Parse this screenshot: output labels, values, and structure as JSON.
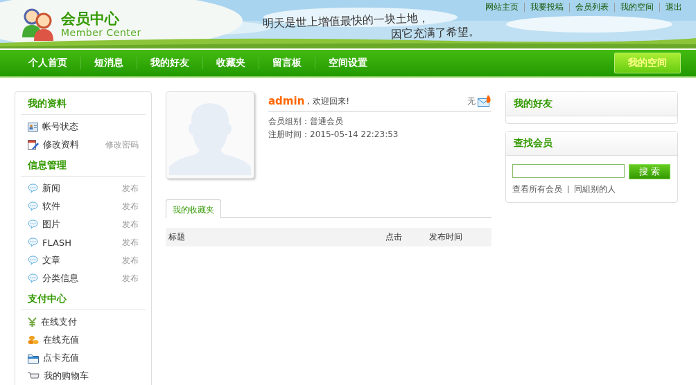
{
  "header": {
    "logo_title": "会员中心",
    "logo_subtitle": "Member Center",
    "slogan": [
      "明天是世上增值最快的一块土地，",
      "因它充满了希望。"
    ],
    "top_links": [
      "网站主页",
      "我要投稿",
      "会员列表",
      "我的空间",
      "退出"
    ]
  },
  "nav": {
    "items": [
      "个人首页",
      "短消息",
      "我的好友",
      "收藏夹",
      "留言板",
      "空间设置"
    ],
    "space_button": "我的空间"
  },
  "sidebar": {
    "sections": [
      {
        "title": "我的资料",
        "items": [
          {
            "kind": "card",
            "label": "帐号状态"
          },
          {
            "kind": "edit",
            "label": "修改资料",
            "action": "修改密码"
          }
        ]
      },
      {
        "title": "信息管理",
        "items": [
          {
            "kind": "chat",
            "label": "新闻",
            "action": "发布"
          },
          {
            "kind": "chat",
            "label": "软件",
            "action": "发布"
          },
          {
            "kind": "chat",
            "label": "图片",
            "action": "发布"
          },
          {
            "kind": "chat",
            "label": "FLASH",
            "action": "发布"
          },
          {
            "kind": "chat",
            "label": "文章",
            "action": "发布"
          },
          {
            "kind": "chat",
            "label": "分类信息",
            "action": "发布"
          }
        ]
      },
      {
        "title": "支付中心",
        "items": [
          {
            "kind": "yen",
            "label": "在线支付"
          },
          {
            "kind": "coins",
            "label": "在线充值"
          },
          {
            "kind": "folder",
            "label": "点卡充值"
          },
          {
            "kind": "cart",
            "label": "我的购物车"
          }
        ]
      }
    ]
  },
  "profile": {
    "username": "admin",
    "greeting": "，欢迎回来!",
    "messages": "无",
    "group": "会员组别：普通会员",
    "registered": "注册时间：2015-05-14 22:23:53"
  },
  "favorites": {
    "tabs": [
      {
        "label": "我的收藏夹",
        "selected": true
      }
    ],
    "columns": [
      "标题",
      "点击",
      "发布时间"
    ]
  },
  "friends": {
    "title": "我的好友"
  },
  "search": {
    "title": "查找会员",
    "button": "搜 索",
    "links": [
      "查看所有会员",
      "同組别的人"
    ]
  }
}
